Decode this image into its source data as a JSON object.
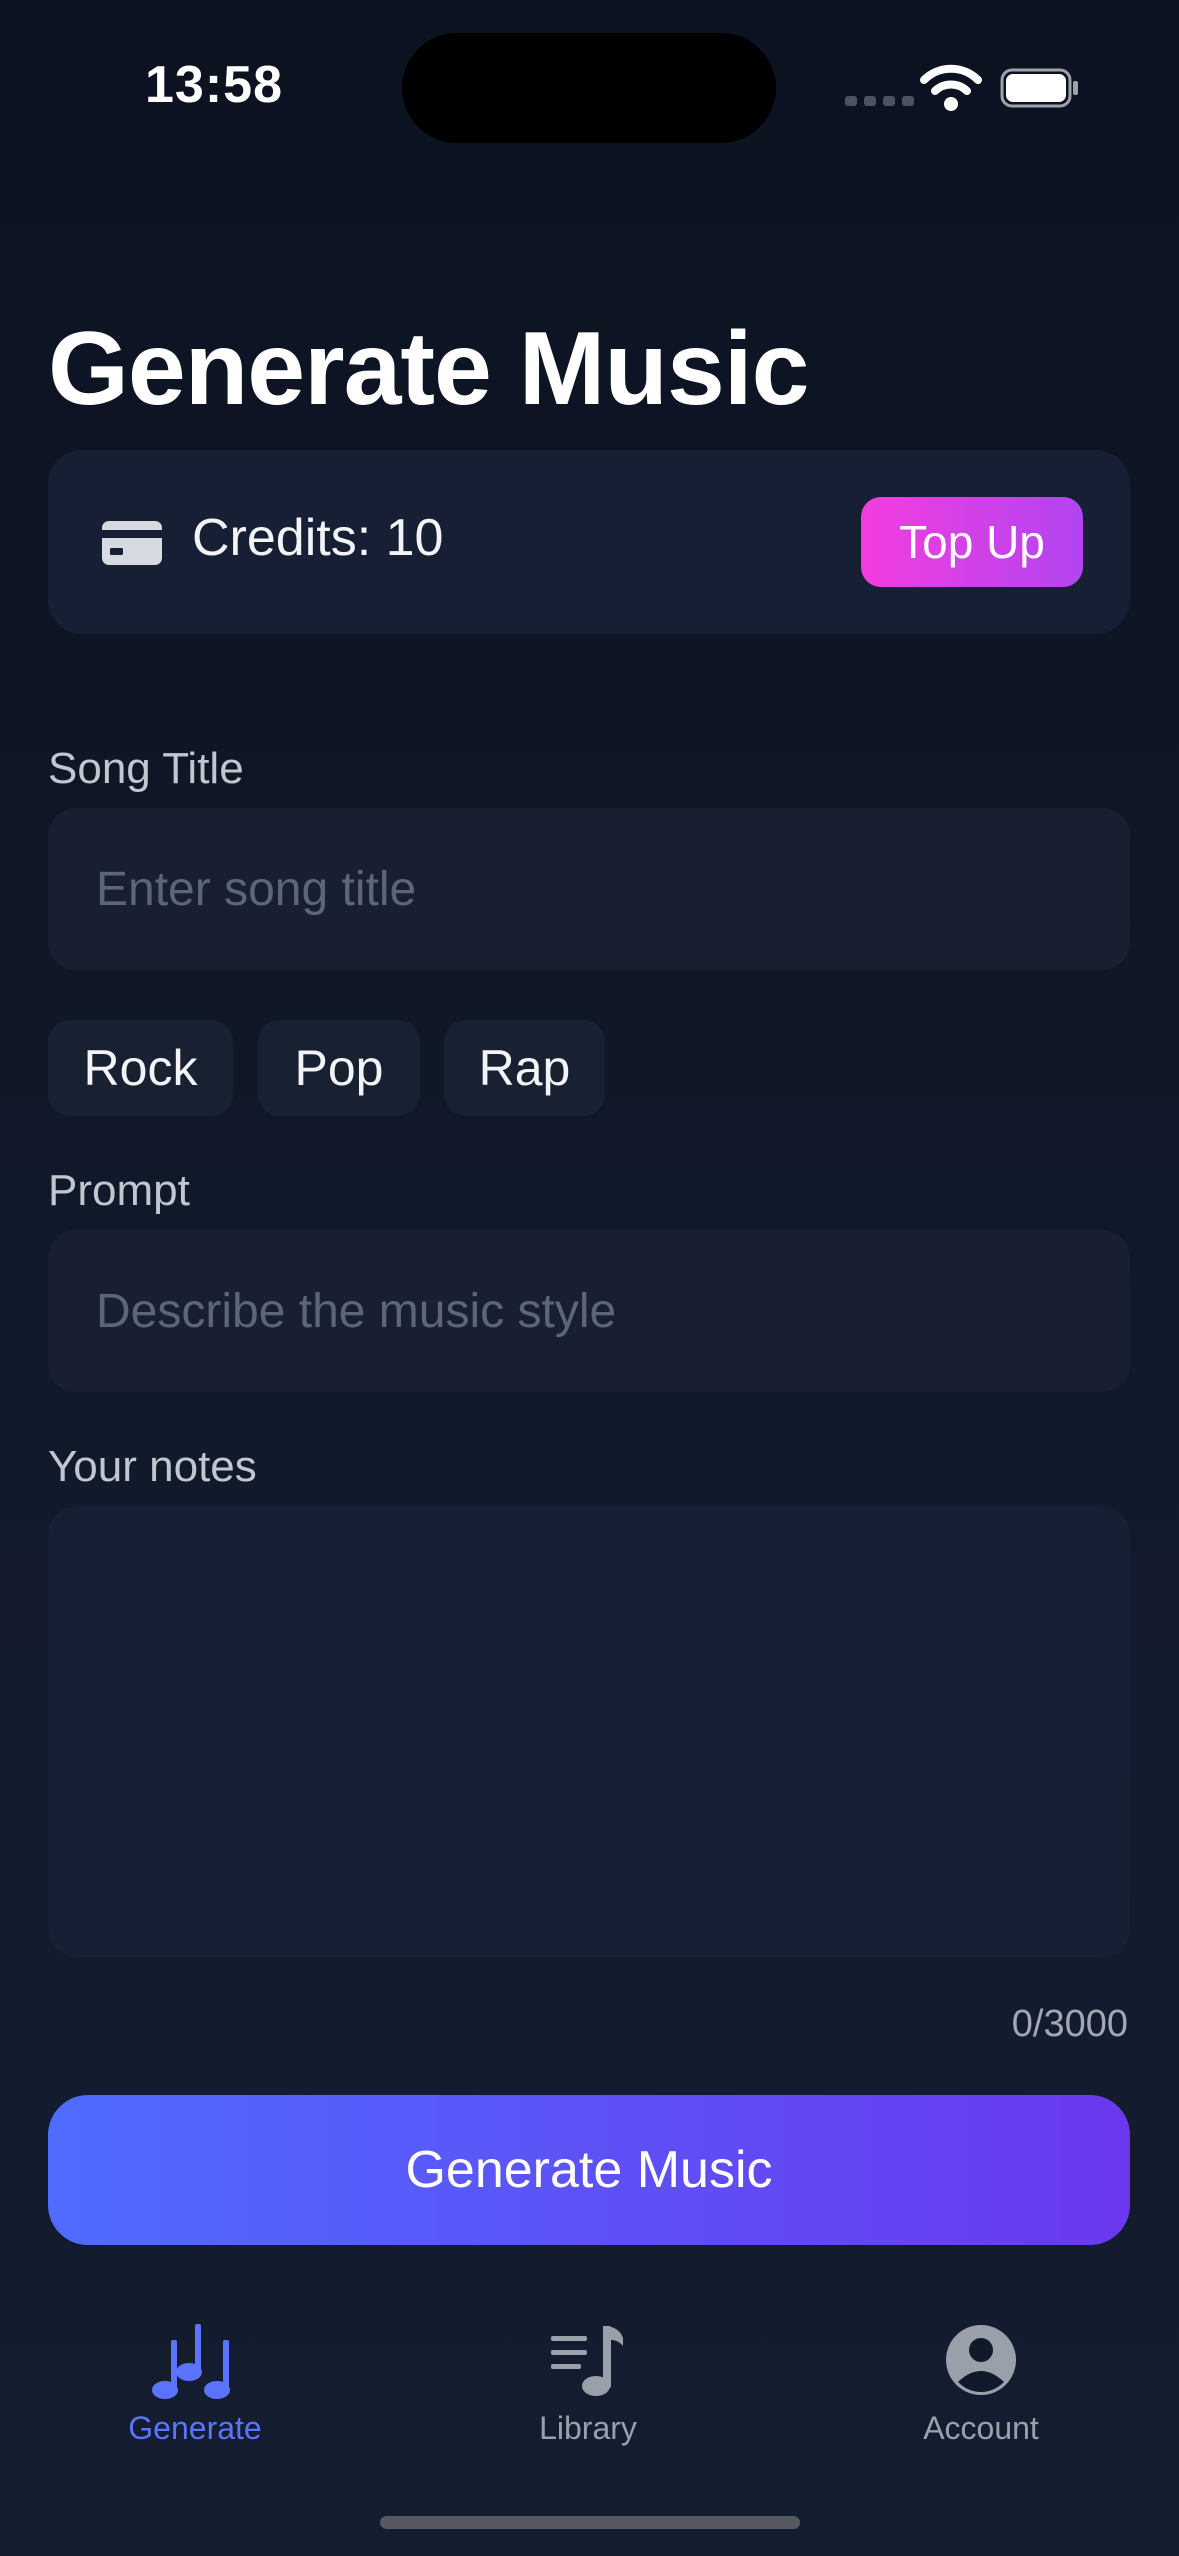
{
  "status_bar": {
    "time": "13:58"
  },
  "header": {
    "title": "Generate Music"
  },
  "credits": {
    "label": "Credits: 10",
    "topup_label": "Top Up"
  },
  "form": {
    "song_title": {
      "label": "Song Title",
      "placeholder": "Enter song title",
      "value": ""
    },
    "genres": [
      "Rock",
      "Pop",
      "Rap"
    ],
    "prompt": {
      "label": "Prompt",
      "placeholder": "Describe the music style",
      "value": ""
    },
    "notes": {
      "label": "Your notes",
      "value": "",
      "counter": "0/3000"
    },
    "submit_label": "Generate Music"
  },
  "tab_bar": {
    "items": [
      {
        "label": "Generate",
        "icon": "music-notes-icon",
        "active": true
      },
      {
        "label": "Library",
        "icon": "music-library-icon",
        "active": false
      },
      {
        "label": "Account",
        "icon": "account-circle-icon",
        "active": false
      }
    ]
  },
  "colors": {
    "accent": "#5b74ff",
    "topup_start": "#f33ce0",
    "topup_end": "#b145f0",
    "generate_start": "#4f6cff",
    "generate_end": "#6a38ee",
    "tab_inactive": "#9aa0aa"
  }
}
